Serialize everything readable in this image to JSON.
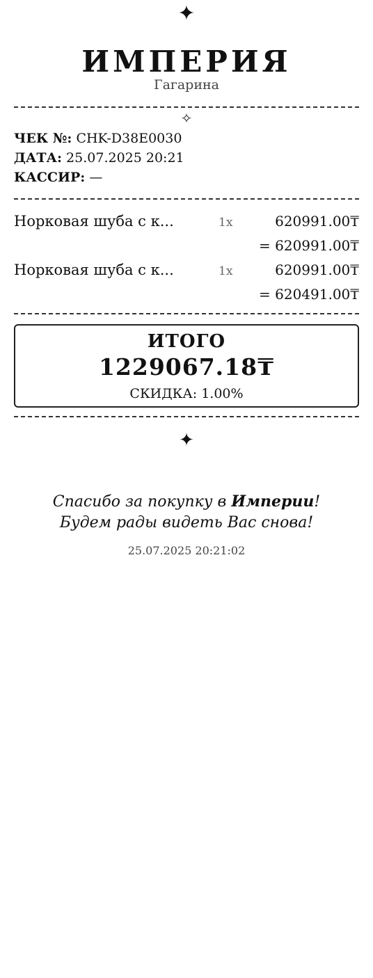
{
  "header": {
    "top_star": "✦",
    "brand": "ИМПЕРИЯ",
    "branch": "Гагарина",
    "divider_icon": "✧"
  },
  "meta": {
    "check_label": "ЧЕК №:",
    "check_value": "CHK-D38E0030",
    "date_label": "ДАТА:",
    "date_value": "25.07.2025 20:21",
    "cashier_label": "КАССИР:",
    "cashier_value": "—"
  },
  "items": [
    {
      "name": "Норковая шуба с к...",
      "qty": "1x",
      "price": "620991.00₸",
      "sum": "= 620991.00₸"
    },
    {
      "name": "Норковая шуба с к...",
      "qty": "1x",
      "price": "620991.00₸",
      "sum": "= 620491.00₸"
    }
  ],
  "total": {
    "label": "ИТОГО",
    "value": "1229067.18₸",
    "discount": "СКИДКА: 1.00%"
  },
  "footer": {
    "bottom_star": "✦",
    "thanks_prefix": "Спасибо за покупку в ",
    "thanks_brand": "Империи",
    "thanks_suffix": "!",
    "see_again": "Будем рады видеть Вас снова!",
    "timestamp": "25.07.2025 20:21:02"
  }
}
